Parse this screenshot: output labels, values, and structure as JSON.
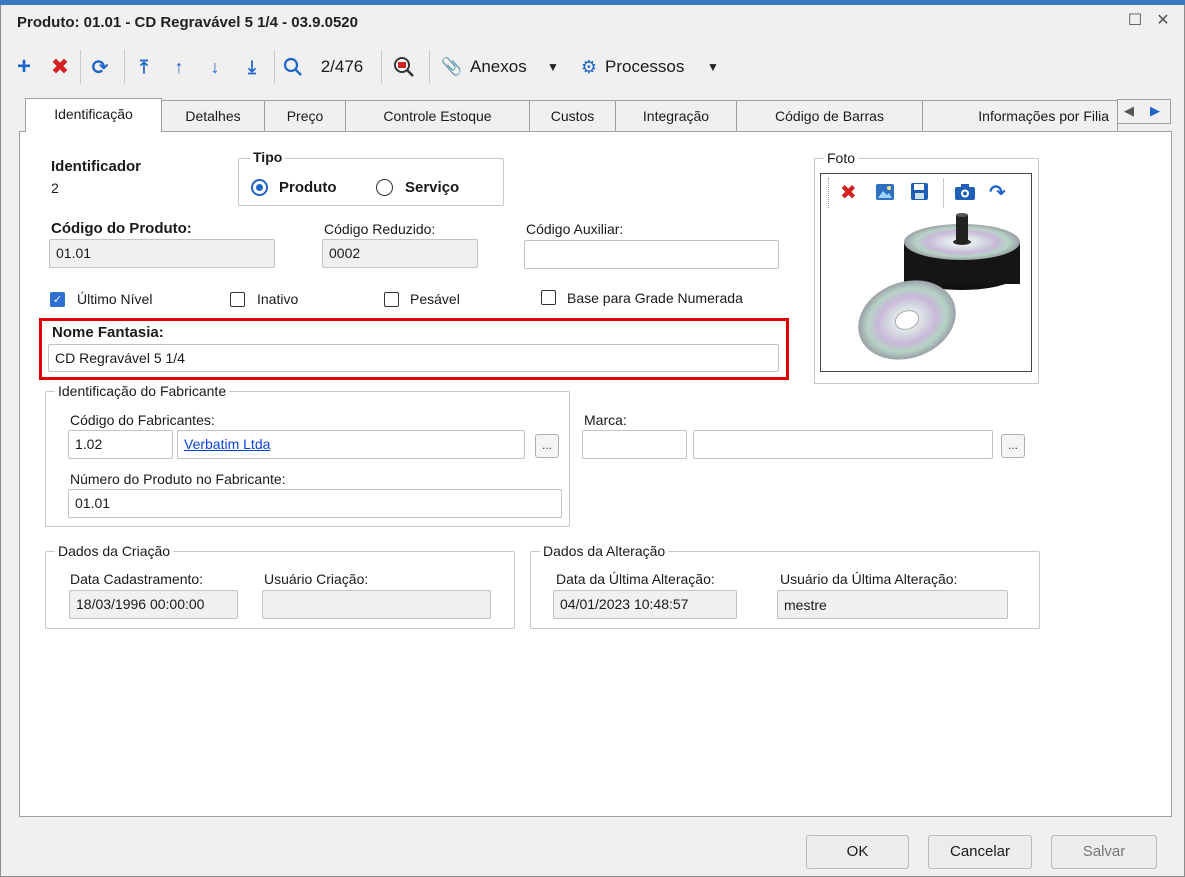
{
  "window": {
    "title": "Produto: 01.01 - CD Regravável 5 1/4 - 03.9.0520"
  },
  "toolbar": {
    "record_position": "2/476",
    "attachments_label": "Anexos",
    "processes_label": "Processos"
  },
  "tabs": [
    {
      "label": "Identificação",
      "active": true
    },
    {
      "label": "Detalhes"
    },
    {
      "label": "Preço"
    },
    {
      "label": "Controle Estoque"
    },
    {
      "label": "Custos"
    },
    {
      "label": "Integração"
    },
    {
      "label": "Código de Barras"
    },
    {
      "label": "Informações por Filia"
    }
  ],
  "form": {
    "identificador_label": "Identificador",
    "identificador_value": "2",
    "tipo_label": "Tipo",
    "tipo_options": [
      "Produto",
      "Serviço"
    ],
    "tipo_selected": "Produto",
    "codigo_produto_label": "Código do Produto:",
    "codigo_produto_value": "01.01",
    "codigo_reduzido_label": "Código Reduzido:",
    "codigo_reduzido_value": "0002",
    "codigo_auxiliar_label": "Código Auxiliar:",
    "codigo_auxiliar_value": "",
    "checkboxes": [
      {
        "label": "Último Nível",
        "checked": true
      },
      {
        "label": "Inativo",
        "checked": false
      },
      {
        "label": "Pesável",
        "checked": false
      },
      {
        "label": "Base para Grade Numerada",
        "checked": false
      }
    ],
    "nome_fantasia_label": "Nome Fantasia:",
    "nome_fantasia_value": "CD Regravável 5 1/4",
    "foto_label": "Foto"
  },
  "fabricante": {
    "group_title": "Identificação do Fabricante",
    "codigo_label": "Código do Fabricantes:",
    "codigo_value": "1.02",
    "nome_value": "Verbatim Ltda",
    "numero_label": "Número do Produto no Fabricante:",
    "numero_value": "01.01",
    "marca_label": "Marca:",
    "marca_code": "",
    "marca_name": "",
    "lookup_label": "..."
  },
  "criacao": {
    "group_title": "Dados da Criação",
    "data_label": "Data Cadastramento:",
    "data_value": "18/03/1996 00:00:00",
    "usuario_label": "Usuário Criação:",
    "usuario_value": ""
  },
  "alteracao": {
    "group_title": "Dados da Alteração",
    "data_label": "Data da Última Alteração:",
    "data_value": "04/01/2023 10:48:57",
    "usuario_label": "Usuário da Última Alteração:",
    "usuario_value": "mestre"
  },
  "buttons": {
    "ok": "OK",
    "cancel": "Cancelar",
    "save": "Salvar"
  },
  "colors": {
    "add": "#1f64c8",
    "delete": "#d32020",
    "highlight": "#e00000",
    "link": "#0b44d6"
  }
}
